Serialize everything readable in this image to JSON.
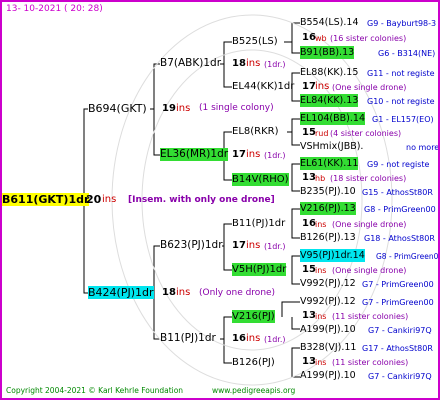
{
  "header": {
    "date": "13- 10-2021 ( 20: 28)"
  },
  "footer": {
    "copyright": "Copyright 2004-2021 © Karl Kehrle Foundation",
    "url": "www.pedigreeapis.org"
  },
  "gen1": {
    "name": "B611(GKT)1dr",
    "num": "20",
    "ins": "ins",
    "note": "[Insem. with only one drone]"
  },
  "gen2": [
    {
      "name": "B694(GKT)",
      "num": "19",
      "ins": "ins",
      "note": "(1 single colony)"
    },
    {
      "name": "B424(PJ)1dr",
      "num": "18",
      "ins": "ins",
      "note": "(Only one drone)"
    }
  ],
  "gen3": [
    {
      "name": "B7(ABK)1dr",
      "num": "18",
      "ins": "ins",
      "note": "(1dr.)"
    },
    {
      "name": "EL36(MR)1dr",
      "num": "17",
      "ins": "ins",
      "note": "(1dr.)"
    },
    {
      "name": "B623(PJ)1dr",
      "num": "17",
      "ins": "ins",
      "note": "(1dr.)"
    },
    {
      "name": "B11(PJ)1dr",
      "num": "16",
      "ins": "ins",
      "note": "(1dr.)"
    }
  ],
  "gen4": [
    {
      "name": "B525(LS)"
    },
    {
      "name": "EL44(KK)1dr",
      "num": "17",
      "ins": "ins",
      "note": "(1dr.)"
    },
    {
      "name": "EL8(RKR)"
    },
    {
      "name": "B14V(RHO)"
    },
    {
      "name": "B11(PJ)1dr"
    },
    {
      "name": "V5H(PJ)1dr"
    },
    {
      "name": "V216(PJ)"
    },
    {
      "name": "B126(PJ)"
    }
  ],
  "gen5": [
    {
      "main": "B554(LS).14",
      "tail": "G9 - Bayburt98-3"
    },
    {
      "num": "16",
      "ins": "wb",
      "note": "(16 sister colonies)"
    },
    {
      "main": "B91(BB).13",
      "tail": "G6 - B314(NE)"
    },
    {
      "main": "EL88(KK).15",
      "tail": "G11 - not registe"
    },
    {
      "num": "17",
      "ins": "ins",
      "note": "(One single drone)"
    },
    {
      "main": "EL84(KK).13",
      "tail": "G10 - not registe"
    },
    {
      "main": "EL104(BB).14",
      "tail": "G1 - EL157(EO)"
    },
    {
      "num": "15",
      "ins": "rud",
      "note": "(4 sister colonies)"
    },
    {
      "main": "VSHmix(JBB).",
      "tail": "no more"
    },
    {
      "main": "EL61(KK).11",
      "tail": "G9 - not registe"
    },
    {
      "num": "13",
      "ins": "hb",
      "note": "(18 sister colonies)"
    },
    {
      "main": "B235(PJ).10",
      "tail": "G15 - AthosSt80R"
    },
    {
      "main": "V216(PJ).13",
      "tail": "G8 - PrimGreen00"
    },
    {
      "num": "16",
      "ins": "ins",
      "note": "(One single drone)"
    },
    {
      "main": "B126(PJ).13",
      "tail": "G18 - AthosSt80R"
    },
    {
      "main": "V95(PJ)1dr.14",
      "tail": "G8 - PrimGreen00"
    },
    {
      "num": "15",
      "ins": "ins",
      "note": "(One single drone)"
    },
    {
      "main": "V992(PJ).12",
      "tail": "G7 - PrimGreen00"
    },
    {
      "main": "V992(PJ).12",
      "tail": "G7 - PrimGreen00"
    },
    {
      "num": "13",
      "ins": "ins",
      "note": "(11 sister colonies)"
    },
    {
      "main": "A199(PJ).10",
      "tail": "G7 - Cankiri97Q"
    },
    {
      "main": "B328(VJ).11",
      "tail": "G17 - AthosSt80R"
    },
    {
      "num": "13",
      "ins": "ins",
      "note": "(11 sister colonies)"
    },
    {
      "main": "A199(PJ).10",
      "tail": "G7 - Cankiri97Q"
    }
  ],
  "colors": {
    "frame": "#cc00cc",
    "insRed": "#cc0000",
    "notePurple": "#8800aa",
    "tailBlue": "#0000cc",
    "highlightGreen": "#33dd33",
    "highlightCyan": "#00e5ee",
    "highlightYellow": "#ffff00"
  }
}
